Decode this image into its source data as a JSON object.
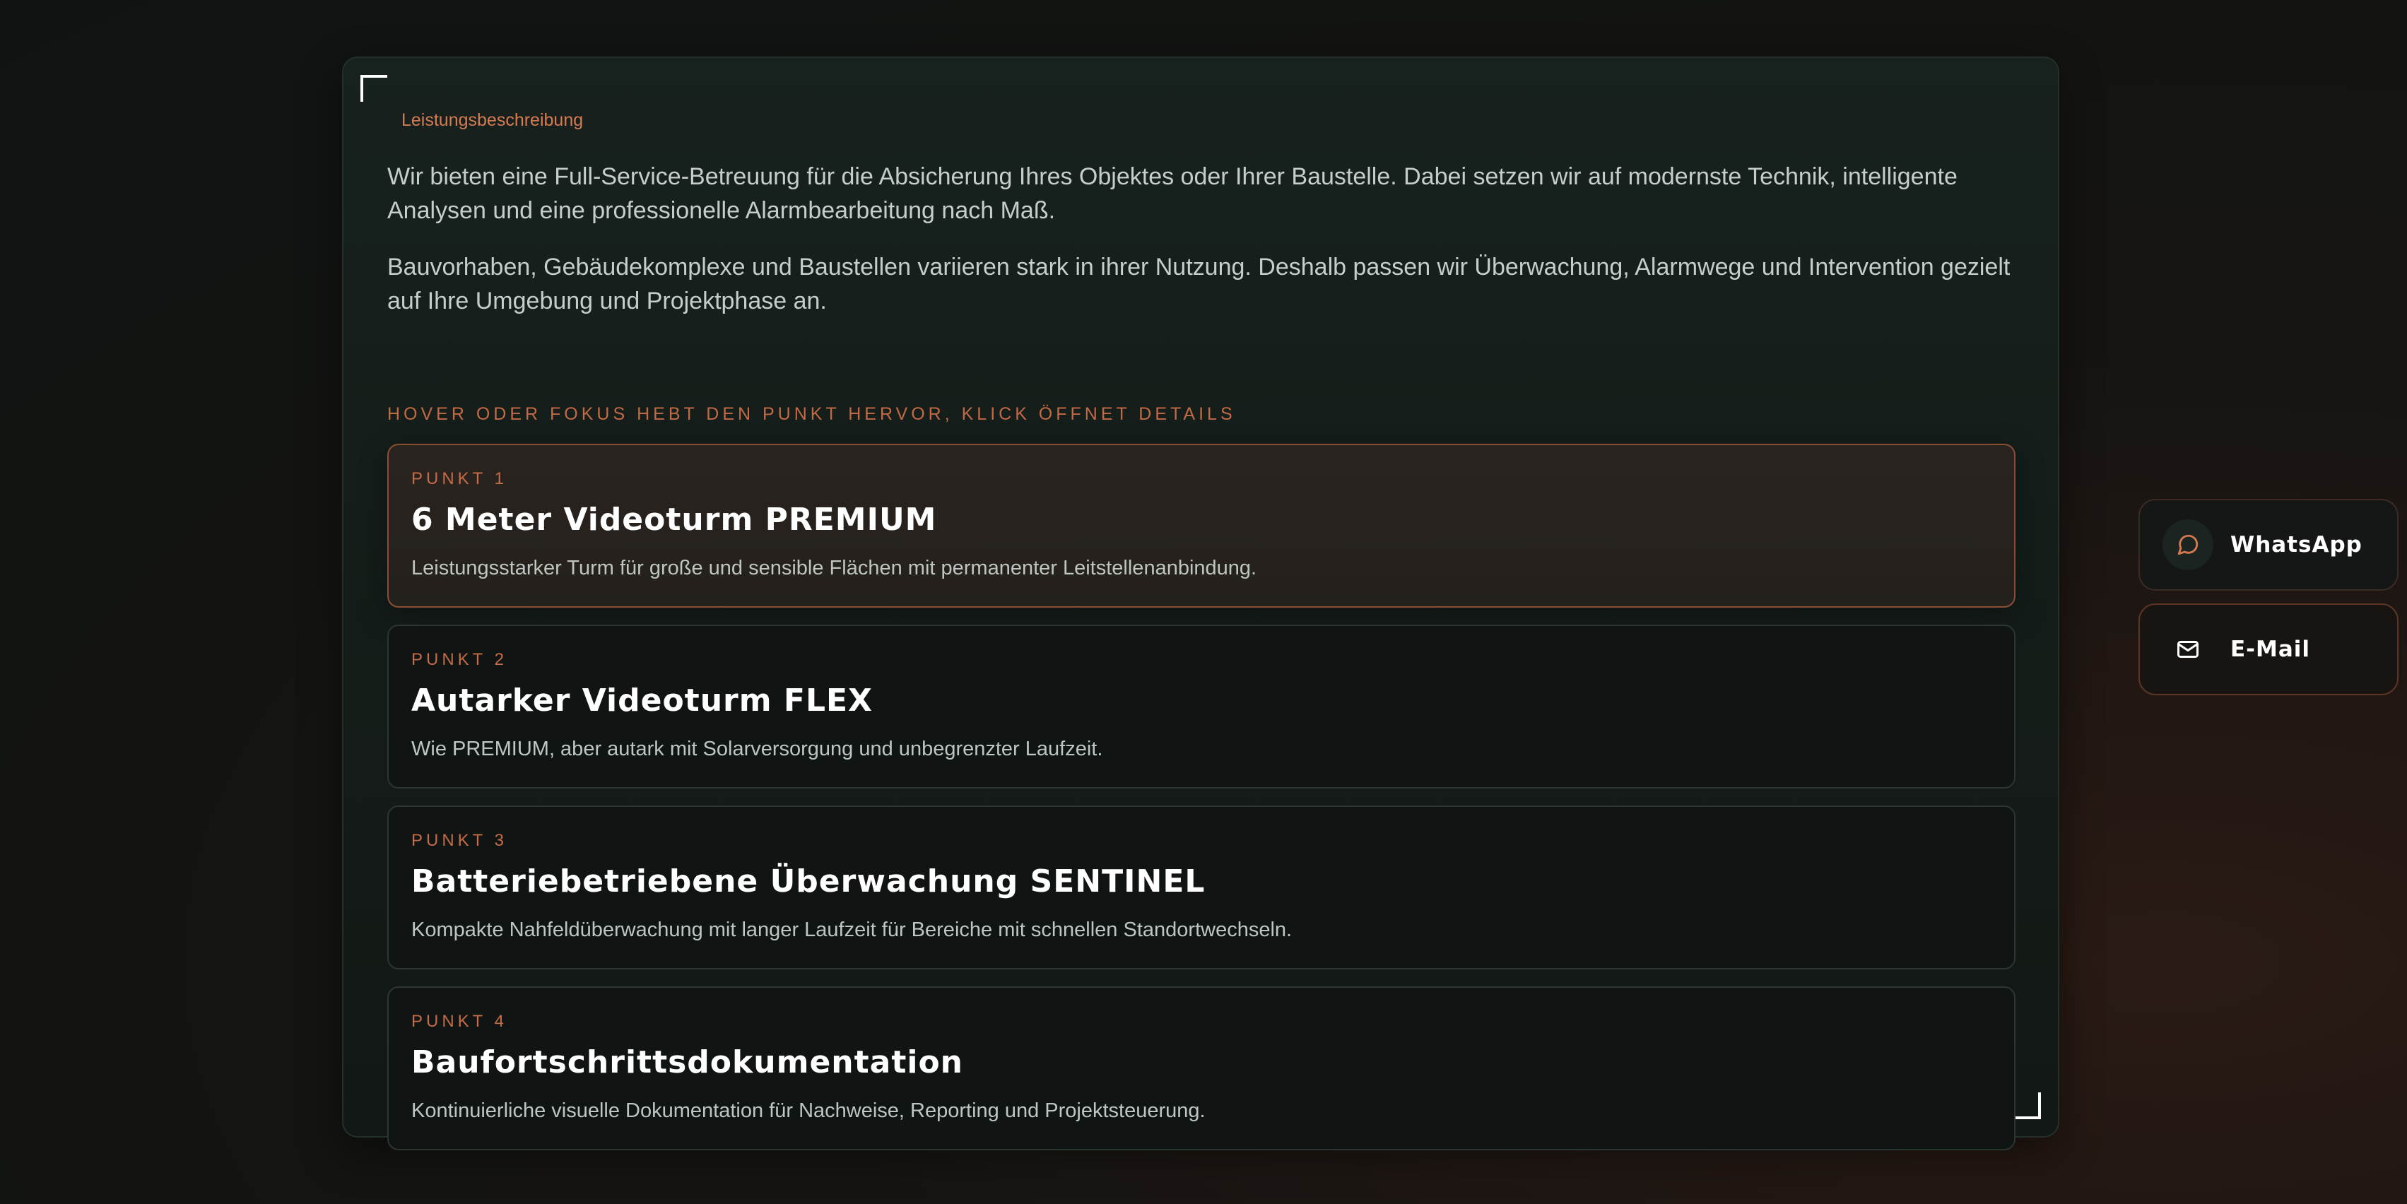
{
  "section": {
    "label": "Leistungsbeschreibung",
    "paragraphs": [
      "Wir bieten eine Full-Service-Betreuung für die Absicherung Ihres Objektes oder Ihrer Baustelle. Dabei setzen wir auf modernste Technik, intelligente Analysen und eine professionelle Alarmbearbeitung nach Maß.",
      "Bauvorhaben, Gebäudekomplexe und Baustellen variieren stark in ihrer Nutzung. Deshalb passen wir Überwachung, Alarmwege und Intervention gezielt auf Ihre Umgebung und Projektphase an."
    ],
    "hint": "HOVER ODER FOKUS HEBT DEN PUNKT HERVOR, KLICK ÖFFNET DETAILS"
  },
  "cards": [
    {
      "kicker": "PUNKT 1",
      "title": "6 Meter Videoturm PREMIUM",
      "description": "Leistungsstarker Turm für große und sensible Flächen mit permanenter Leitstellenanbindung."
    },
    {
      "kicker": "PUNKT 2",
      "title": "Autarker Videoturm FLEX",
      "description": "Wie PREMIUM, aber autark mit Solarversorgung und unbegrenzter Laufzeit."
    },
    {
      "kicker": "PUNKT 3",
      "title": "Batteriebetriebene Überwachung SENTINEL",
      "description": "Kompakte Nahfeldüberwachung mit langer Laufzeit für Bereiche mit schnellen Standortwechseln."
    },
    {
      "kicker": "PUNKT 4",
      "title": "Baufortschrittsdokumentation",
      "description": "Kontinuierliche visuelle Dokumentation für Nachweise, Reporting und Projektsteuerung."
    }
  ],
  "contact": {
    "whatsapp_label": "WhatsApp",
    "whatsapp_icon": "chat-bubble-icon",
    "email_label": "E-Mail",
    "email_icon": "envelope-icon"
  },
  "colors": {
    "accent": "#d67a52",
    "active_border": "#8a4e36",
    "panel_border": "#243029"
  }
}
